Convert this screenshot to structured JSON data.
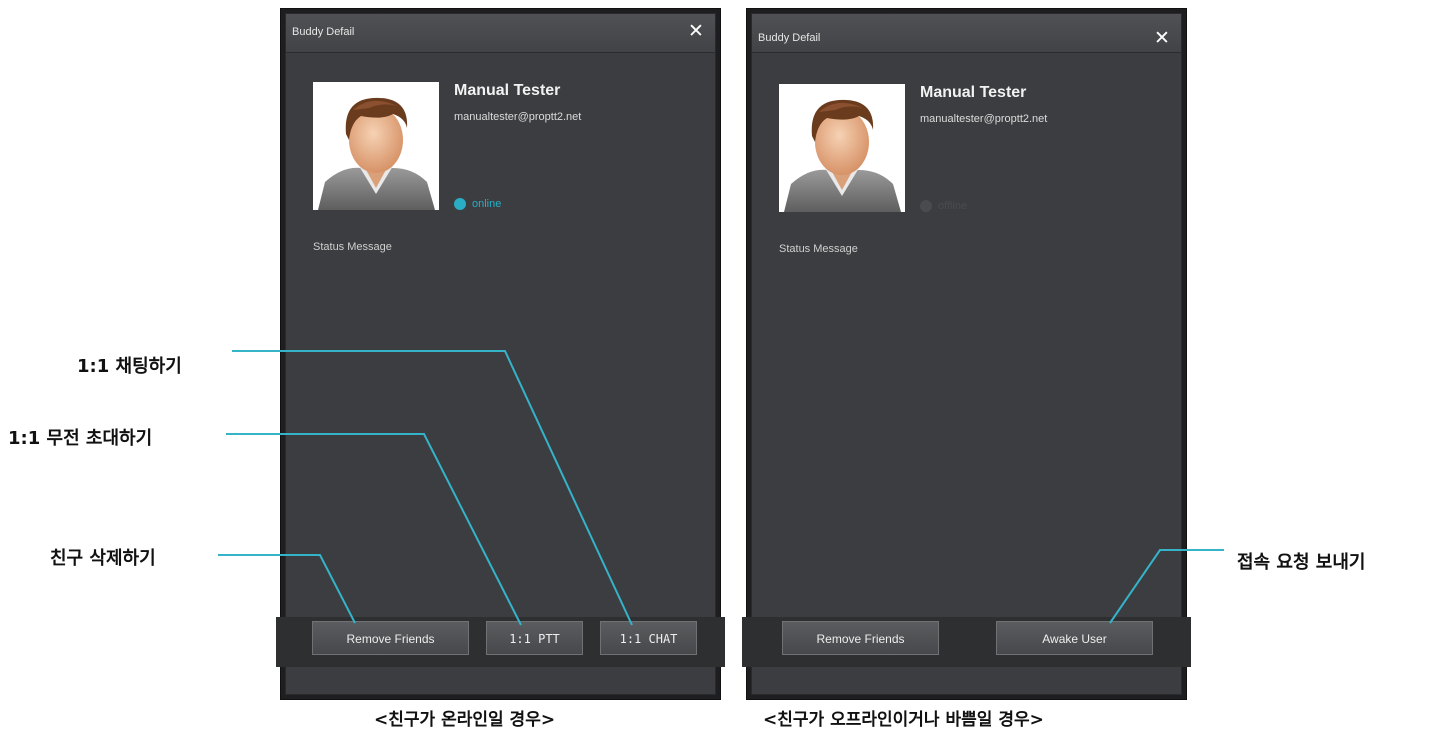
{
  "left_window": {
    "title": "Buddy Defail",
    "close_icon": "✕",
    "name": "Manual Tester",
    "email": "manualtester@proptt2.net",
    "status": "online",
    "status_message_label": "Status Message",
    "buttons": {
      "remove": "Remove Friends",
      "ptt": "1:1 PTT",
      "chat": "1:1 CHAT"
    },
    "caption": "<친구가 온라인일 경우>"
  },
  "right_window": {
    "title": "Buddy Defail",
    "close_icon": "✕",
    "name": "Manual Tester",
    "email": "manualtester@proptt2.net",
    "status": "offline",
    "status_message_label": "Status Message",
    "buttons": {
      "remove": "Remove Friends",
      "awake": "Awake User"
    },
    "caption": "<친구가 오프라인이거나 바쁨일 경우>"
  },
  "callouts": {
    "chat": "1:1 채팅하기",
    "ptt": "1:1 무전 초대하기",
    "remove": "친구 삭제하기",
    "awake": "접속 요청 보내기"
  },
  "colors": {
    "accent": "#2aaec6",
    "window_bg": "#3c3d40",
    "offline_dot": "#4a4b4e"
  }
}
